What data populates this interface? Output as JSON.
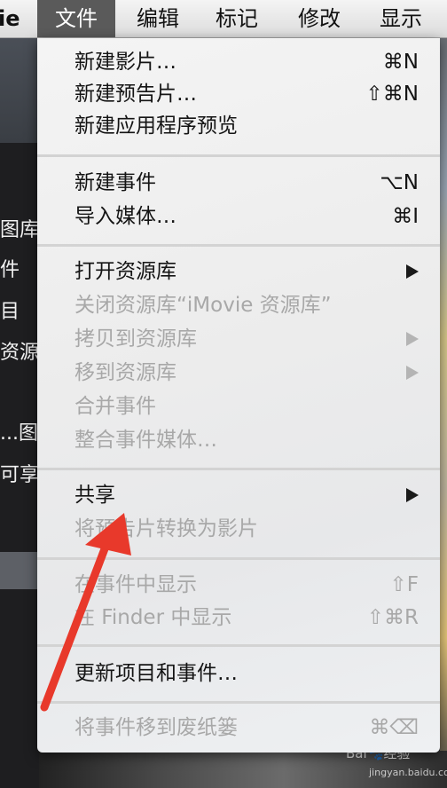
{
  "menubar": {
    "app_fragment": "ie",
    "items": [
      "文件",
      "编辑",
      "标记",
      "修改",
      "显示"
    ]
  },
  "sidebar": {
    "items": [
      "图库",
      "件",
      "目",
      "资源",
      "...图",
      "可享"
    ]
  },
  "menu": {
    "groups": [
      [
        {
          "label": "新建影片…",
          "shortcut": "⌘N",
          "enabled": true
        },
        {
          "label": "新建预告片…",
          "shortcut": "⇧⌘N",
          "enabled": true
        },
        {
          "label": "新建应用程序预览",
          "shortcut": "",
          "enabled": true
        }
      ],
      [
        {
          "label": "新建事件",
          "shortcut": "⌥N",
          "enabled": true
        },
        {
          "label": "导入媒体…",
          "shortcut": "⌘I",
          "enabled": true
        }
      ],
      [
        {
          "label": "打开资源库",
          "submenu": true,
          "enabled": true
        },
        {
          "label": "关闭资源库“iMovie 资源库”",
          "enabled": false
        },
        {
          "label": "拷贝到资源库",
          "submenu": true,
          "enabled": false
        },
        {
          "label": "移到资源库",
          "submenu": true,
          "enabled": false
        },
        {
          "label": "合并事件",
          "enabled": false
        },
        {
          "label": "整合事件媒体…",
          "enabled": false
        }
      ],
      [
        {
          "label": "共享",
          "submenu": true,
          "enabled": true
        },
        {
          "label": "将预告片转换为影片",
          "enabled": false
        }
      ],
      [
        {
          "label": "在事件中显示",
          "shortcut": "⇧F",
          "enabled": false
        },
        {
          "label": "在 Finder 中显示",
          "shortcut": "⇧⌘R",
          "enabled": false
        }
      ],
      [
        {
          "label": "更新项目和事件…",
          "enabled": true
        }
      ],
      [
        {
          "label": "将事件移到废纸篓",
          "shortcut": "⌘⌫",
          "enabled": false
        }
      ]
    ]
  },
  "watermark": {
    "main": "Bai🐾经验",
    "sub": "jingyan.baidu.com"
  },
  "colors": {
    "annotation_arrow": "#e8392b",
    "menu_highlight": "#5a5a5a"
  }
}
